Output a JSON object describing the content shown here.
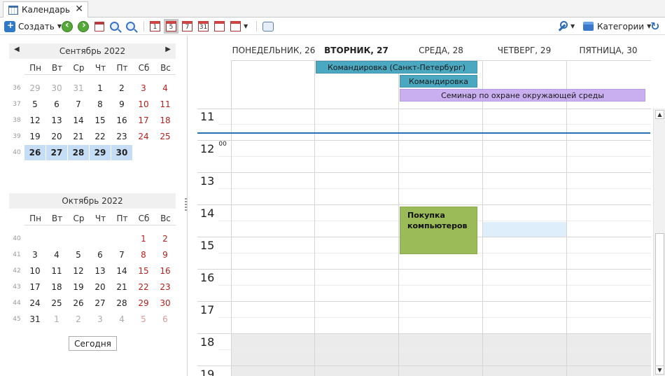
{
  "tab": {
    "title": "Календарь",
    "close": "✕"
  },
  "toolbar": {
    "create_label": "Создать",
    "categories_label": "Категории",
    "view_day_num": "1",
    "view_workweek_num": "5",
    "view_week_num": "7",
    "view_month_num": "31"
  },
  "sidebar": {
    "month1": {
      "title": "Сентябрь 2022",
      "weekdays": [
        "Пн",
        "Вт",
        "Ср",
        "Чт",
        "Пт",
        "Сб",
        "Вс"
      ],
      "weeks": [
        {
          "num": "36",
          "days": [
            "29",
            "30",
            "31",
            "1",
            "2",
            "3",
            "4"
          ]
        },
        {
          "num": "37",
          "days": [
            "5",
            "6",
            "7",
            "8",
            "9",
            "10",
            "11"
          ]
        },
        {
          "num": "38",
          "days": [
            "12",
            "13",
            "14",
            "15",
            "16",
            "17",
            "18"
          ]
        },
        {
          "num": "39",
          "days": [
            "19",
            "20",
            "21",
            "22",
            "23",
            "24",
            "25"
          ]
        },
        {
          "num": "40",
          "days": [
            "26",
            "27",
            "28",
            "29",
            "30",
            "",
            ""
          ]
        }
      ]
    },
    "month2": {
      "title": "Октябрь 2022",
      "weekdays": [
        "Пн",
        "Вт",
        "Ср",
        "Чт",
        "Пт",
        "Сб",
        "Вс"
      ],
      "weeks": [
        {
          "num": "40",
          "days": [
            "",
            "",
            "",
            "",
            "",
            "1",
            "2"
          ]
        },
        {
          "num": "41",
          "days": [
            "3",
            "4",
            "5",
            "6",
            "7",
            "8",
            "9"
          ]
        },
        {
          "num": "42",
          "days": [
            "10",
            "11",
            "12",
            "13",
            "14",
            "15",
            "16"
          ]
        },
        {
          "num": "43",
          "days": [
            "17",
            "18",
            "19",
            "20",
            "21",
            "22",
            "23"
          ]
        },
        {
          "num": "44",
          "days": [
            "24",
            "25",
            "26",
            "27",
            "28",
            "29",
            "30"
          ]
        },
        {
          "num": "45",
          "days": [
            "31",
            "1",
            "2",
            "3",
            "4",
            "5",
            "6"
          ]
        }
      ]
    },
    "today_label": "Сегодня"
  },
  "calendar": {
    "columns": [
      "ПОНЕДЕЛЬНИК, 26",
      "ВТОРНИК, 27",
      "СРЕДА, 28",
      "ЧЕТВЕРГ, 29",
      "ПЯТНИЦА, 30"
    ],
    "hours": [
      "11",
      "12",
      "13",
      "14",
      "15",
      "16",
      "17",
      "18",
      "19"
    ],
    "minutes_label": "00",
    "allday_events": [
      {
        "title": "Командировка (Санкт-Петербург)"
      },
      {
        "title": "Командировка"
      },
      {
        "title": "Семинар по охране окружающей среды"
      }
    ],
    "timed_events": [
      {
        "title": "Покупка компьютеров"
      }
    ]
  }
}
